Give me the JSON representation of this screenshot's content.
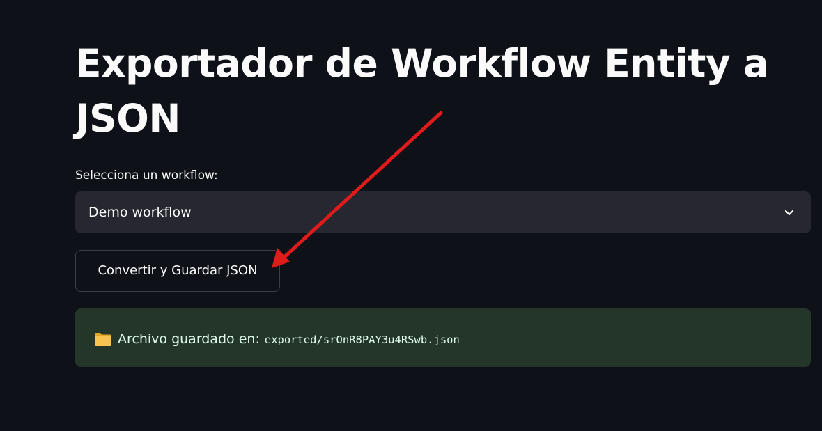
{
  "page": {
    "title": "Exportador de Workflow Entity a JSON"
  },
  "workflow_select": {
    "label": "Selecciona un workflow:",
    "selected_value": "Demo workflow",
    "icon": "chevron-down-icon"
  },
  "convert_button": {
    "label": "Convertir y Guardar JSON"
  },
  "success_alert": {
    "icon": "folder-icon",
    "message": "Archivo guardado en:",
    "path": "exported/srOnR8PAY3u4RSwb.json"
  },
  "annotation": {
    "arrow_color": "#e01b1b"
  },
  "colors": {
    "background": "#0e1117",
    "select_background": "#262730",
    "success_background": "#233629",
    "success_text": "#dffde9"
  }
}
